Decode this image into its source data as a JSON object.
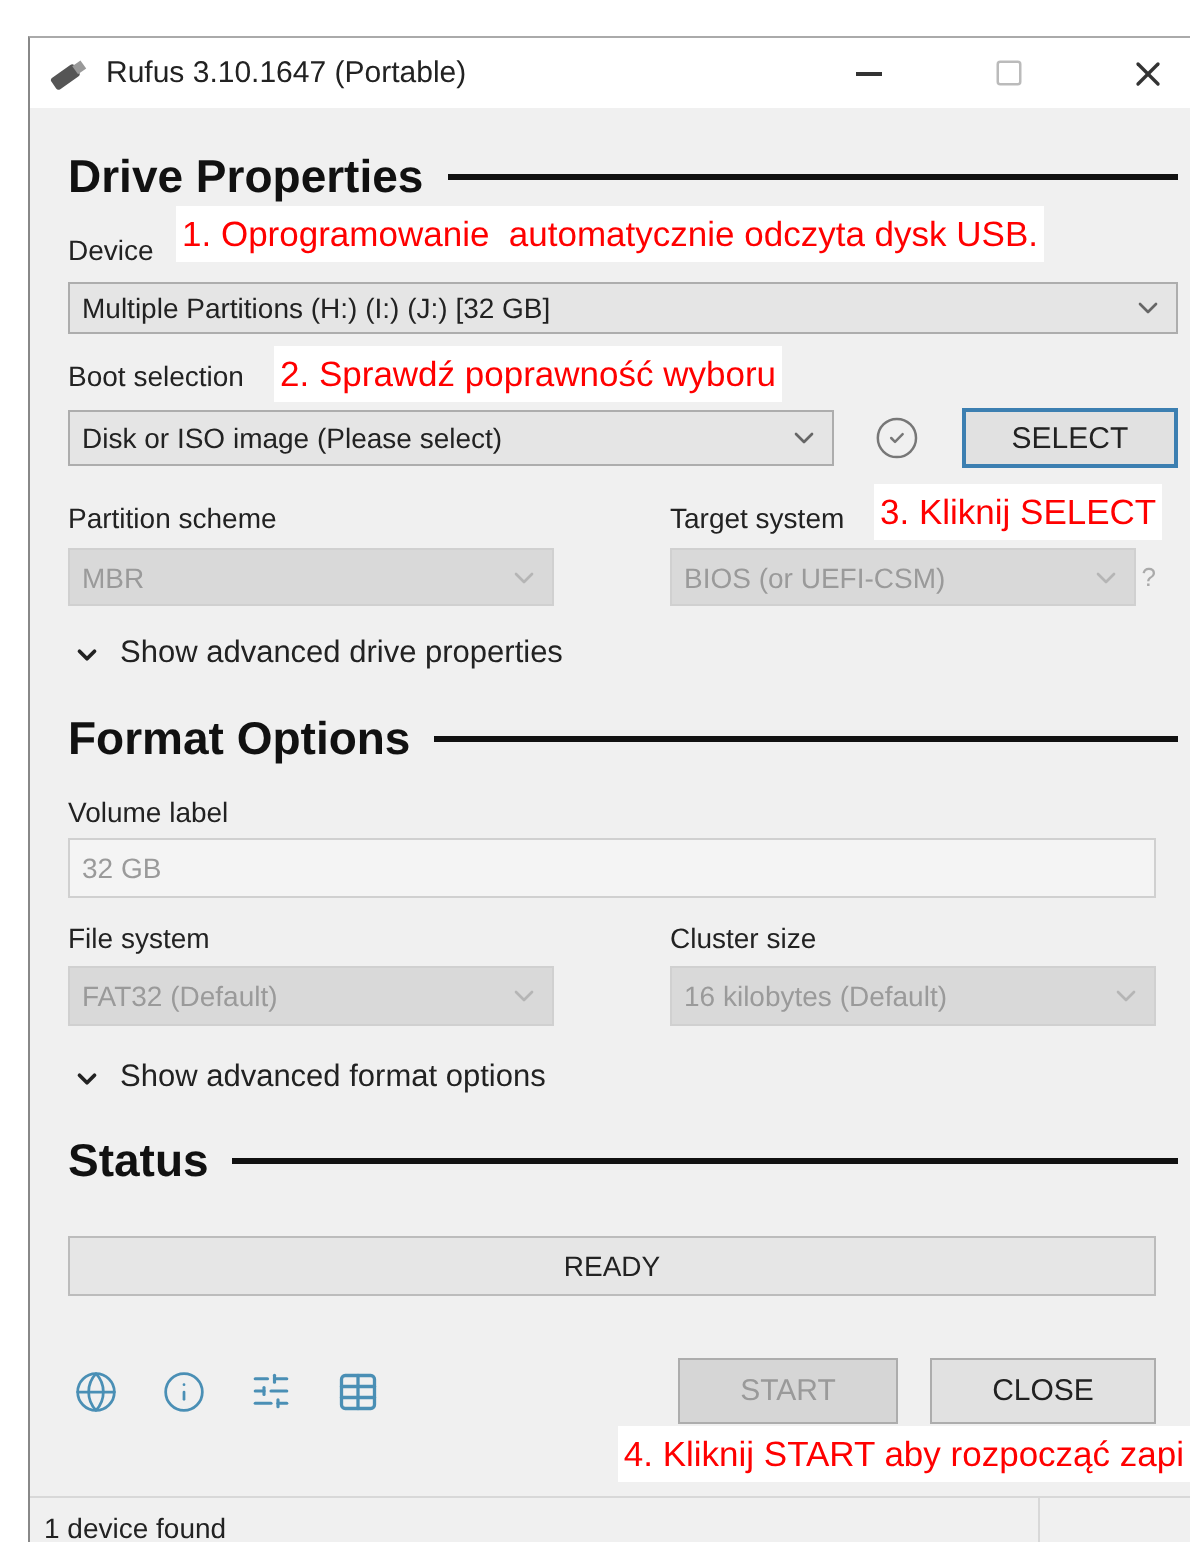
{
  "window": {
    "title": "Rufus 3.10.1647 (Portable)"
  },
  "drive_properties": {
    "heading": "Drive Properties",
    "device": {
      "label": "Device",
      "value": "Multiple Partitions (H:) (I:) (J:) [32 GB]",
      "disabled": false
    },
    "boot_selection": {
      "label": "Boot selection",
      "value": "Disk or ISO image (Please select)",
      "disabled": false
    },
    "select_button": "SELECT",
    "partition_scheme": {
      "label": "Partition scheme",
      "value": "MBR",
      "disabled": true
    },
    "target_system": {
      "label": "Target system",
      "value": "BIOS (or UEFI-CSM)",
      "disabled": true
    },
    "help_mark": "?",
    "advanced_toggle": {
      "label": "Show advanced drive properties",
      "expanded": false
    }
  },
  "format_options": {
    "heading": "Format Options",
    "volume_label": {
      "label": "Volume label",
      "value": "32 GB",
      "disabled": true
    },
    "file_system": {
      "label": "File system",
      "value": "FAT32 (Default)",
      "disabled": true
    },
    "cluster_size": {
      "label": "Cluster size",
      "value": "16 kilobytes (Default)",
      "disabled": true
    },
    "advanced_toggle": {
      "label": "Show advanced format options",
      "expanded": false
    }
  },
  "status": {
    "heading": "Status",
    "progress": {
      "text": "READY"
    }
  },
  "buttons": [
    {
      "label": "START",
      "disabled": true
    },
    {
      "label": "CLOSE",
      "disabled": false
    }
  ],
  "status_bar": {
    "text": "1 device found"
  },
  "annotations": [
    {
      "text": "1. Oprogramowanie  automatycznie odczyta dysk USB."
    },
    {
      "text": "2. Sprawdź poprawność wyboru"
    },
    {
      "text": "3. Kliknij SELECT"
    },
    {
      "text": "4. Kliknij START aby rozpocząć zapi"
    }
  ]
}
